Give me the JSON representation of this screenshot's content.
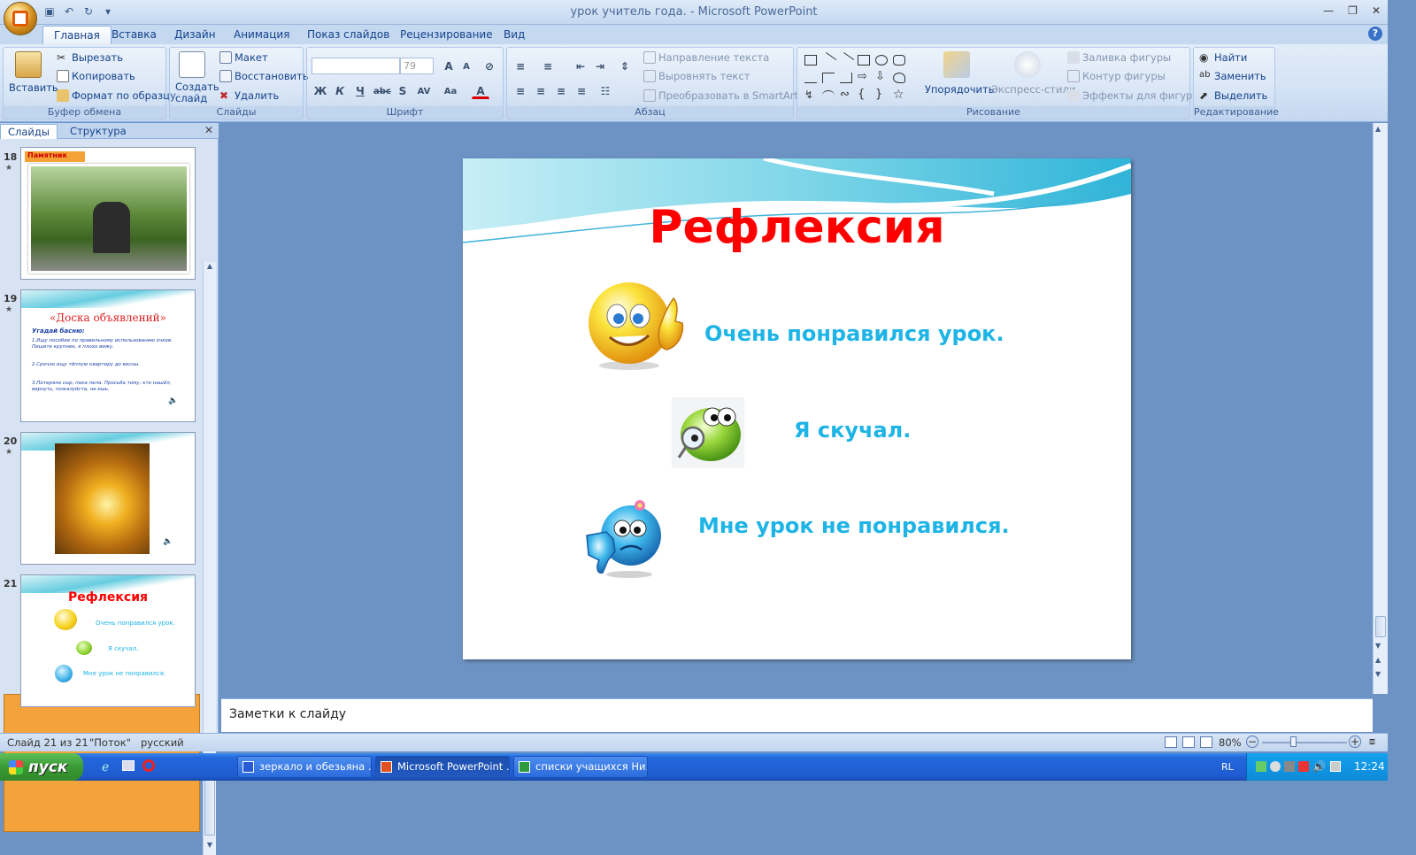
{
  "window": {
    "title": "урок учитель года. - Microsoft PowerPoint"
  },
  "tabs": [
    "Главная",
    "Вставка",
    "Дизайн",
    "Анимация",
    "Показ слайдов",
    "Рецензирование",
    "Вид"
  ],
  "ribbon": {
    "clipboard": {
      "label": "Буфер обмена",
      "paste": "Вставить",
      "cut": "Вырезать",
      "copy": "Копировать",
      "format": "Формат по образцу"
    },
    "slides": {
      "label": "Слайды",
      "new_slide": "Создать слайд",
      "layout": "Макет",
      "reset": "Восстановить",
      "delete": "Удалить"
    },
    "font": {
      "label": "Шрифт",
      "size": "79"
    },
    "paragraph": {
      "label": "Абзац",
      "text_dir": "Направление текста",
      "align_text": "Выровнять текст",
      "smartart": "Преобразовать в SmartArt"
    },
    "drawing": {
      "label": "Рисование",
      "arrange": "Упорядочить",
      "quick_styles": "Экспресс-стили",
      "fill": "Заливка фигуры",
      "outline": "Контур фигуры",
      "effects": "Эффекты для фигур"
    },
    "editing": {
      "label": "Редактирование",
      "find": "Найти",
      "replace": "Заменить",
      "select": "Выделить"
    }
  },
  "panel": {
    "tab_slides": "Слайды",
    "tab_outline": "Структура"
  },
  "thumbnails": [
    {
      "num": "18",
      "title": "Памятник"
    },
    {
      "num": "19",
      "title": "«Доска объявлений»",
      "subtitle": "Угадай басню:",
      "line1": "1.Ищу пособие по правильному использованию очков. Пишите крупнее, я плохо вижу.",
      "line2": "2.Срочно ищу тёплую квартиру до весны.",
      "line3": "3.Потеряла сыр, пока пела. Просьба тому, кто нашёл, вернуть, пожалуйста, не ешь."
    },
    {
      "num": "20"
    },
    {
      "num": "21",
      "title": "Рефлексия",
      "l1": "Очень понравился урок.",
      "l2": "Я скучал.",
      "l3": "Мне урок не понравился."
    }
  ],
  "slide": {
    "title": "Рефлексия",
    "line1": "Очень понравился урок.",
    "line2": "Я скучал.",
    "line3": "Мне урок не понравился."
  },
  "notes": {
    "placeholder": "Заметки к слайду"
  },
  "status": {
    "slide": "Слайд 21 из 21",
    "theme": "\"Поток\"",
    "lang": "русский",
    "zoom": "80%"
  },
  "taskbar": {
    "start": "пуск",
    "task1": "зеркало и обезьяна ...",
    "task2": "Microsoft PowerPoint ...",
    "task3": "списки учащихся Ни...",
    "lang": "RL",
    "time": "12:24"
  }
}
